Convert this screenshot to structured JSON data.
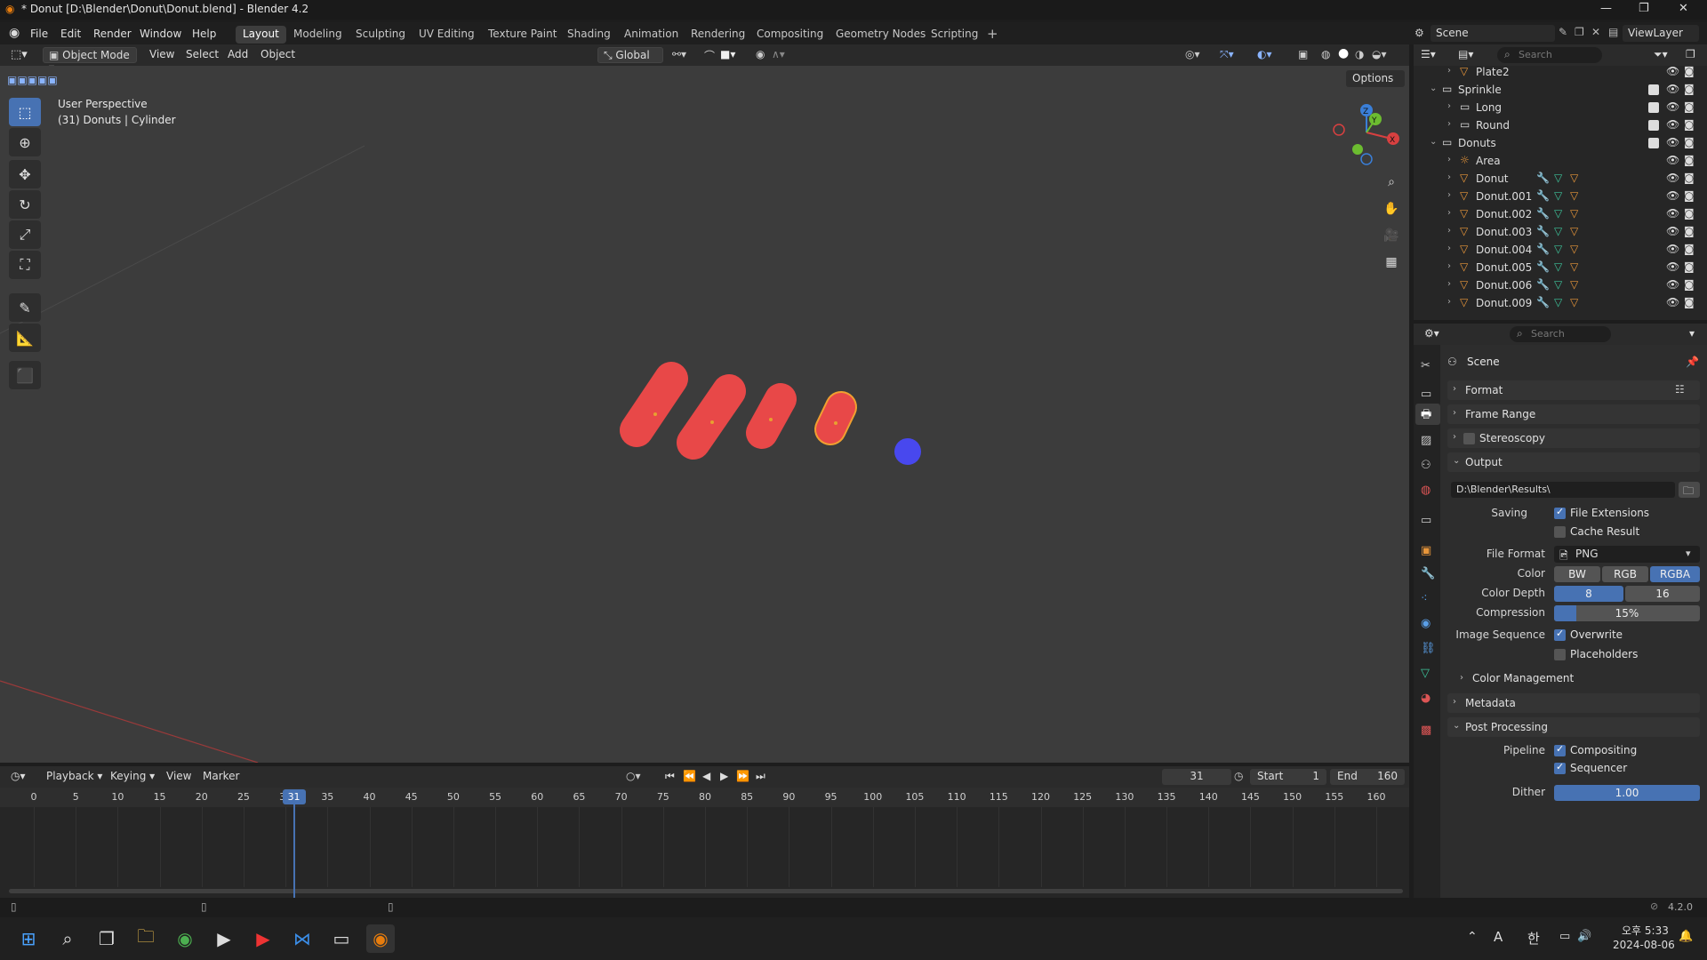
{
  "window": {
    "title": "* Donut [D:\\Blender\\Donut\\Donut.blend] - Blender 4.2"
  },
  "menu": [
    "File",
    "Edit",
    "Render",
    "Window",
    "Help"
  ],
  "workspaces": [
    "Layout",
    "Modeling",
    "Sculpting",
    "UV Editing",
    "Texture Paint",
    "Shading",
    "Animation",
    "Rendering",
    "Compositing",
    "Geometry Nodes",
    "Scripting"
  ],
  "active_workspace": "Layout",
  "scene_bar": {
    "scene": "Scene",
    "view_layer": "ViewLayer"
  },
  "viewport_header": {
    "mode": "Object Mode",
    "menus": [
      "View",
      "Select",
      "Add",
      "Object"
    ],
    "orientation": "Global",
    "options": "Options"
  },
  "viewport": {
    "perspective": "User Perspective",
    "object_info": "(31) Donuts | Cylinder"
  },
  "outliner": {
    "search_placeholder": "Search",
    "rows": [
      {
        "name": "Plate2",
        "indent": 2,
        "type": "mesh",
        "expanded": false
      },
      {
        "name": "Sprinkle",
        "indent": 1,
        "type": "collection",
        "expanded": true
      },
      {
        "name": "Long",
        "indent": 2,
        "type": "collection",
        "expanded": false
      },
      {
        "name": "Round",
        "indent": 2,
        "type": "collection",
        "expanded": false
      },
      {
        "name": "Donuts",
        "indent": 1,
        "type": "collection",
        "expanded": true
      },
      {
        "name": "Area",
        "indent": 2,
        "type": "light",
        "expanded": false
      },
      {
        "name": "Donut",
        "indent": 2,
        "type": "mesh",
        "expanded": false
      },
      {
        "name": "Donut.001",
        "indent": 2,
        "type": "mesh",
        "expanded": false
      },
      {
        "name": "Donut.002",
        "indent": 2,
        "type": "mesh",
        "expanded": false
      },
      {
        "name": "Donut.003",
        "indent": 2,
        "type": "mesh",
        "expanded": false
      },
      {
        "name": "Donut.004",
        "indent": 2,
        "type": "mesh",
        "expanded": false
      },
      {
        "name": "Donut.005",
        "indent": 2,
        "type": "mesh",
        "expanded": false
      },
      {
        "name": "Donut.006",
        "indent": 2,
        "type": "mesh",
        "expanded": false
      },
      {
        "name": "Donut.009",
        "indent": 2,
        "type": "mesh",
        "expanded": false
      }
    ]
  },
  "properties": {
    "search_placeholder": "Search",
    "context": "Scene",
    "panels": {
      "format": "Format",
      "frame_range": "Frame Range",
      "stereoscopy": "Stereoscopy",
      "output": "Output",
      "color_management": "Color Management",
      "metadata": "Metadata",
      "post_processing": "Post Processing"
    },
    "output_path": "D:\\Blender\\Results\\",
    "labels": {
      "saving": "Saving",
      "file_format": "File Format",
      "color": "Color",
      "color_depth": "Color Depth",
      "compression": "Compression",
      "image_sequence": "Image Sequence",
      "pipeline": "Pipeline",
      "dither": "Dither"
    },
    "checks": {
      "file_extensions": "File Extensions",
      "cache_result": "Cache Result",
      "overwrite": "Overwrite",
      "placeholders": "Placeholders",
      "compositing": "Compositing",
      "sequencer": "Sequencer"
    },
    "file_format": "PNG",
    "color_options": [
      "BW",
      "RGB",
      "RGBA"
    ],
    "color_selected": "RGBA",
    "depth_options": [
      "8",
      "16"
    ],
    "depth_selected": "8",
    "compression": "15%",
    "compression_value": 0.15,
    "dither": "1.00"
  },
  "timeline": {
    "menus": [
      "Playback",
      "Keying",
      "View",
      "Marker"
    ],
    "current_frame": "31",
    "start_label": "Start",
    "start": "1",
    "end_label": "End",
    "end": "160",
    "ticks": [
      "0",
      "5",
      "10",
      "15",
      "20",
      "25",
      "30",
      "35",
      "40",
      "45",
      "50",
      "55",
      "60",
      "65",
      "70",
      "75",
      "80",
      "85",
      "90",
      "95",
      "100",
      "105",
      "110",
      "115",
      "120",
      "125",
      "130",
      "135",
      "140",
      "145",
      "150",
      "155",
      "160"
    ]
  },
  "status": {
    "version": "4.2.0"
  },
  "taskbar": {
    "time": "오후 5:33",
    "date": "2024-08-06",
    "ime": "A",
    "lang": "한"
  },
  "colors": {
    "accent": "#4772b3",
    "object_red": "#e84848",
    "selected_outline": "#f0a030",
    "sphere_blue": "#4848ee"
  }
}
